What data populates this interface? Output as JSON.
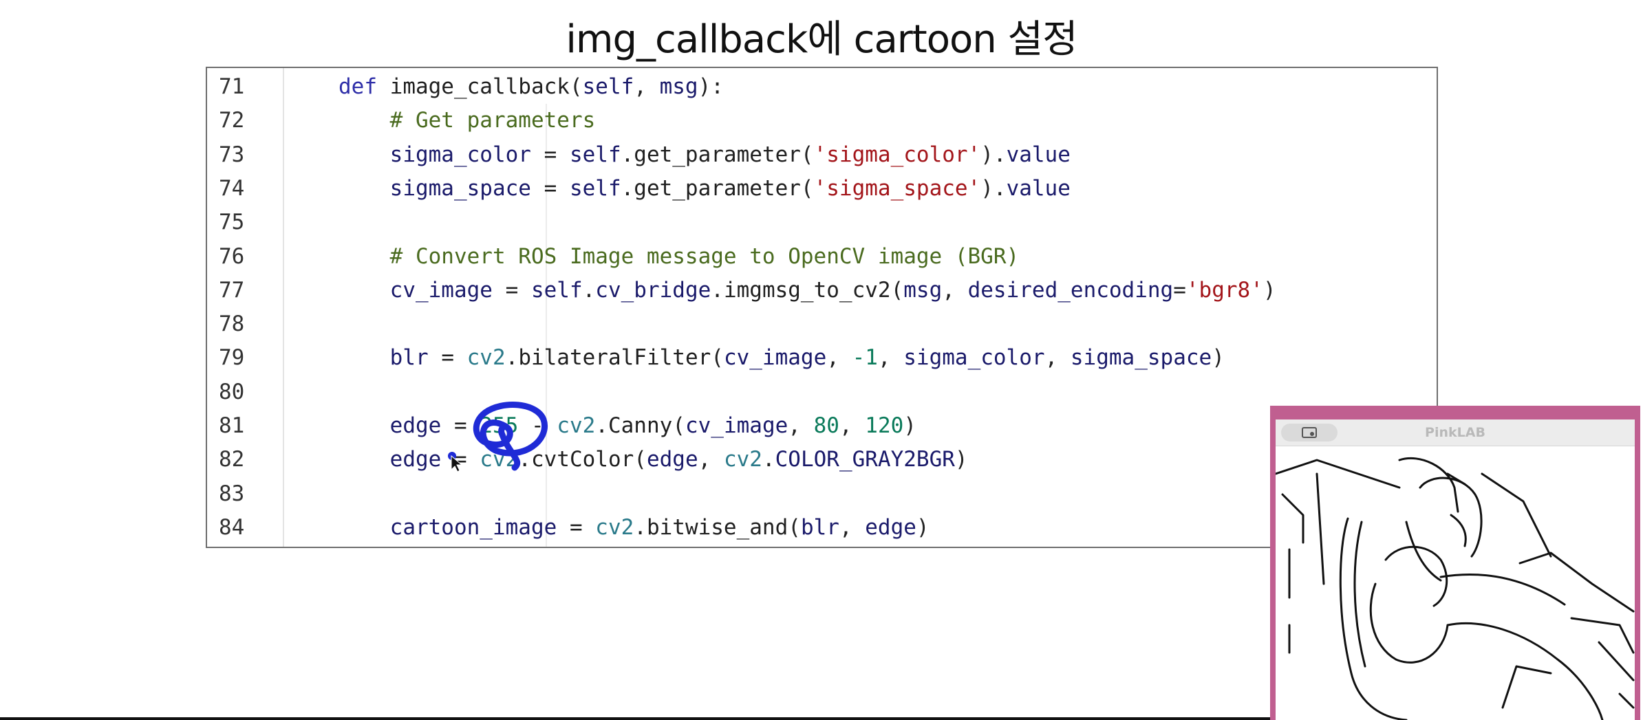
{
  "slide": {
    "title": "img_callback에 cartoon 설정"
  },
  "code": {
    "lines": [
      {
        "num": "71",
        "tokens": [
          [
            "k",
            "def "
          ],
          [
            "f",
            "image_callback"
          ],
          [
            "p",
            "("
          ],
          [
            "v",
            "self"
          ],
          [
            "p",
            ", "
          ],
          [
            "v",
            "msg"
          ],
          [
            "p",
            "):"
          ]
        ]
      },
      {
        "num": "72",
        "tokens": [
          [
            "c",
            "    # Get parameters"
          ]
        ]
      },
      {
        "num": "73",
        "tokens": [
          [
            "v",
            "    sigma_color "
          ],
          [
            "p",
            "= "
          ],
          [
            "v",
            "self"
          ],
          [
            "p",
            "."
          ],
          [
            "f",
            "get_parameter"
          ],
          [
            "p",
            "("
          ],
          [
            "s",
            "'sigma_color'"
          ],
          [
            "p",
            ")."
          ],
          [
            "v",
            "value"
          ]
        ]
      },
      {
        "num": "74",
        "tokens": [
          [
            "v",
            "    sigma_space "
          ],
          [
            "p",
            "= "
          ],
          [
            "v",
            "self"
          ],
          [
            "p",
            "."
          ],
          [
            "f",
            "get_parameter"
          ],
          [
            "p",
            "("
          ],
          [
            "s",
            "'sigma_space'"
          ],
          [
            "p",
            ")."
          ],
          [
            "v",
            "value"
          ]
        ]
      },
      {
        "num": "75",
        "tokens": []
      },
      {
        "num": "76",
        "tokens": [
          [
            "c",
            "    # Convert ROS Image message to OpenCV image (BGR)"
          ]
        ]
      },
      {
        "num": "77",
        "tokens": [
          [
            "v",
            "    cv_image "
          ],
          [
            "p",
            "= "
          ],
          [
            "v",
            "self"
          ],
          [
            "p",
            "."
          ],
          [
            "v",
            "cv_bridge"
          ],
          [
            "p",
            "."
          ],
          [
            "f",
            "imgmsg_to_cv2"
          ],
          [
            "p",
            "("
          ],
          [
            "v",
            "msg"
          ],
          [
            "p",
            ", "
          ],
          [
            "v",
            "desired_encoding"
          ],
          [
            "p",
            "="
          ],
          [
            "s",
            "'bgr8'"
          ],
          [
            "p",
            ")"
          ]
        ]
      },
      {
        "num": "78",
        "tokens": []
      },
      {
        "num": "79",
        "tokens": [
          [
            "v",
            "    blr "
          ],
          [
            "p",
            "= "
          ],
          [
            "m",
            "cv2"
          ],
          [
            "p",
            "."
          ],
          [
            "f",
            "bilateralFilter"
          ],
          [
            "p",
            "("
          ],
          [
            "v",
            "cv_image"
          ],
          [
            "p",
            ", "
          ],
          [
            "n",
            "-1"
          ],
          [
            "p",
            ", "
          ],
          [
            "v",
            "sigma_color"
          ],
          [
            "p",
            ", "
          ],
          [
            "v",
            "sigma_space"
          ],
          [
            "p",
            ")"
          ]
        ]
      },
      {
        "num": "80",
        "tokens": []
      },
      {
        "num": "81",
        "tokens": [
          [
            "v",
            "    edge "
          ],
          [
            "p",
            "= "
          ],
          [
            "n",
            "255"
          ],
          [
            "p",
            " - "
          ],
          [
            "m",
            "cv2"
          ],
          [
            "p",
            "."
          ],
          [
            "f",
            "Canny"
          ],
          [
            "p",
            "("
          ],
          [
            "v",
            "cv_image"
          ],
          [
            "p",
            ", "
          ],
          [
            "n",
            "80"
          ],
          [
            "p",
            ", "
          ],
          [
            "n",
            "120"
          ],
          [
            "p",
            ")"
          ]
        ]
      },
      {
        "num": "82",
        "tokens": [
          [
            "v",
            "    edge "
          ],
          [
            "p",
            "= "
          ],
          [
            "m",
            "cv2"
          ],
          [
            "p",
            "."
          ],
          [
            "f",
            "cvtColor"
          ],
          [
            "p",
            "("
          ],
          [
            "v",
            "edge"
          ],
          [
            "p",
            ", "
          ],
          [
            "m",
            "cv2"
          ],
          [
            "p",
            "."
          ],
          [
            "v",
            "COLOR_GRAY2BGR"
          ],
          [
            "p",
            ")"
          ]
        ]
      },
      {
        "num": "83",
        "tokens": []
      },
      {
        "num": "84",
        "tokens": [
          [
            "v",
            "    cartoon_image "
          ],
          [
            "p",
            "= "
          ],
          [
            "m",
            "cv2"
          ],
          [
            "p",
            "."
          ],
          [
            "f",
            "bitwise_and"
          ],
          [
            "p",
            "("
          ],
          [
            "v",
            "blr"
          ],
          [
            "p",
            ", "
          ],
          [
            "v",
            "edge"
          ],
          [
            "p",
            ")"
          ]
        ]
      }
    ]
  },
  "video_window": {
    "title": "PinkLAB",
    "accent_color": "#c05f90",
    "feed": "edge-detected camera image"
  },
  "annotation": {
    "color": "#1f2bd6",
    "shape": "hand-drawn circle around 255"
  }
}
